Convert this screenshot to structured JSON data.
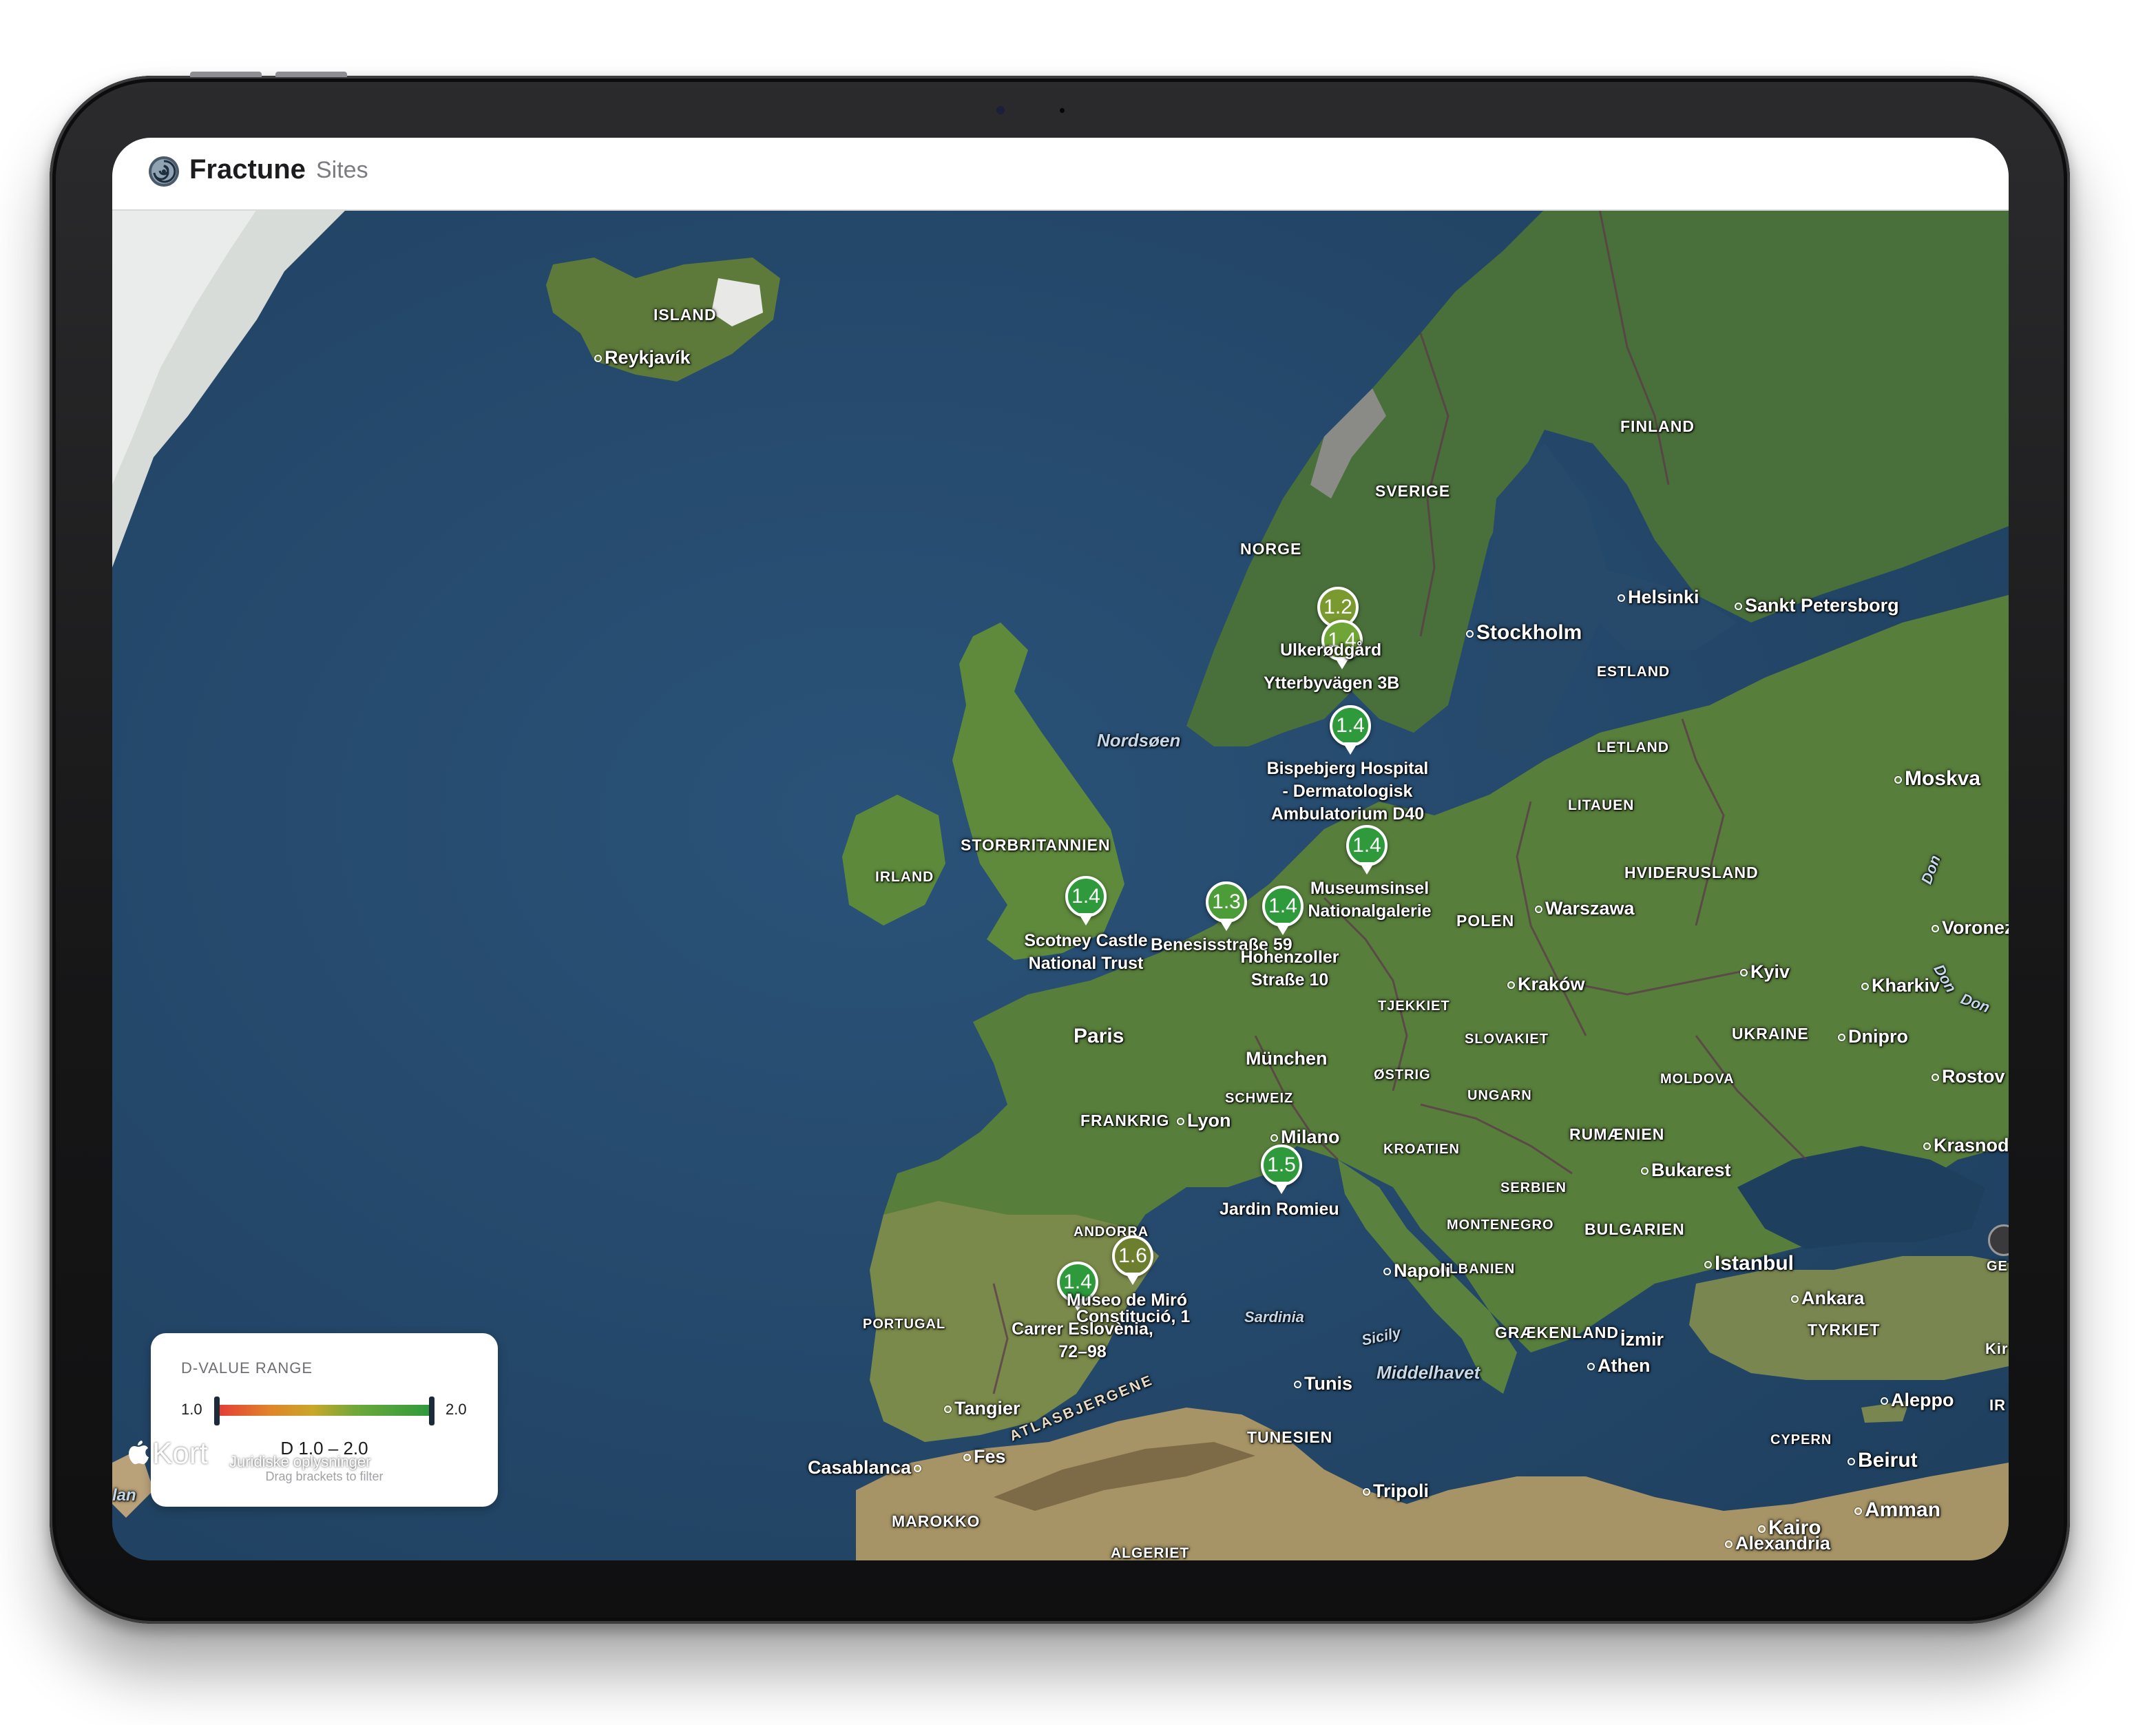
{
  "app": {
    "name": "Fractune",
    "nav_item": "Sites"
  },
  "map": {
    "countries": [
      {
        "key": "island",
        "label": "ISLAND"
      },
      {
        "key": "norge",
        "label": "NORGE"
      },
      {
        "key": "sverige",
        "label": "SVERIGE"
      },
      {
        "key": "finland",
        "label": "FINLAND"
      },
      {
        "key": "estland",
        "label": "ESTLAND"
      },
      {
        "key": "letland",
        "label": "LETLAND"
      },
      {
        "key": "litauen",
        "label": "LITAUEN"
      },
      {
        "key": "hviderusland",
        "label": "HVIDERUSLAND"
      },
      {
        "key": "polen",
        "label": "POLEN"
      },
      {
        "key": "storbritannien",
        "label": "STORBRITANNIEN"
      },
      {
        "key": "irland",
        "label": "IRLAND"
      },
      {
        "key": "tjekkiet",
        "label": "TJEKKIET"
      },
      {
        "key": "slovakiet",
        "label": "SLOVAKIET"
      },
      {
        "key": "ukraine",
        "label": "UKRAINE"
      },
      {
        "key": "moldova",
        "label": "MOLDOVA"
      },
      {
        "key": "ostrig",
        "label": "ØSTRIG"
      },
      {
        "key": "ungarn",
        "label": "UNGARN"
      },
      {
        "key": "schweiz",
        "label": "SCHWEIZ"
      },
      {
        "key": "frankrig",
        "label": "FRANKRIG"
      },
      {
        "key": "kroatien",
        "label": "KROATIEN"
      },
      {
        "key": "rumaenien",
        "label": "RUMÆNIEN"
      },
      {
        "key": "serbien",
        "label": "SERBIEN"
      },
      {
        "key": "montenegro",
        "label": "MONTENEGRO"
      },
      {
        "key": "bulgarien",
        "label": "BULGARIEN"
      },
      {
        "key": "albanien",
        "label": "ALBANIEN"
      },
      {
        "key": "graekenland",
        "label": "GRÆKENLAND"
      },
      {
        "key": "tyrkiet",
        "label": "TYRKIET"
      },
      {
        "key": "andorra",
        "label": "ANDORRA"
      },
      {
        "key": "portugal",
        "label": "PORTUGAL"
      },
      {
        "key": "tunesien",
        "label": "TUNESIEN"
      },
      {
        "key": "marokko",
        "label": "MAROKKO"
      },
      {
        "key": "algeriet",
        "label": "ALGERIET"
      },
      {
        "key": "cypern",
        "label": "CYPERN"
      },
      {
        "key": "atlas",
        "label": "ATLASBJERGENE"
      }
    ],
    "cities": [
      {
        "key": "reykjavik",
        "label": "Reykjavík"
      },
      {
        "key": "stockholm",
        "label": "Stockholm"
      },
      {
        "key": "helsinki",
        "label": "Helsinki"
      },
      {
        "key": "sankt",
        "label": "Sankt Petersborg"
      },
      {
        "key": "moskva",
        "label": "Moskva"
      },
      {
        "key": "warszawa",
        "label": "Warszawa"
      },
      {
        "key": "voronezh",
        "label": "Voronezj"
      },
      {
        "key": "krakow",
        "label": "Kraków"
      },
      {
        "key": "kyiv",
        "label": "Kyiv"
      },
      {
        "key": "kharkiv",
        "label": "Kharkiv"
      },
      {
        "key": "dnipro",
        "label": "Dnipro"
      },
      {
        "key": "rostov",
        "label": "Rostov"
      },
      {
        "key": "krasnodar",
        "label": "Krasnoda"
      },
      {
        "key": "paris",
        "label": "Paris"
      },
      {
        "key": "munchen",
        "label": "München"
      },
      {
        "key": "lyon",
        "label": "Lyon"
      },
      {
        "key": "milano",
        "label": "Milano"
      },
      {
        "key": "bukarest",
        "label": "Bukarest"
      },
      {
        "key": "istanbul",
        "label": "Istanbul"
      },
      {
        "key": "ankara",
        "label": "Ankara"
      },
      {
        "key": "napoli",
        "label": "Napoli"
      },
      {
        "key": "izmir",
        "label": "İzmir"
      },
      {
        "key": "athen",
        "label": "Athen"
      },
      {
        "key": "tunis",
        "label": "Tunis"
      },
      {
        "key": "tangier",
        "label": "Tangier"
      },
      {
        "key": "casablanca",
        "label": "Casablanca"
      },
      {
        "key": "fes",
        "label": "Fes"
      },
      {
        "key": "tripoli",
        "label": "Tripoli"
      },
      {
        "key": "aleppo",
        "label": "Aleppo"
      },
      {
        "key": "beirut",
        "label": "Beirut"
      },
      {
        "key": "amman",
        "label": "Amman"
      },
      {
        "key": "alexandria",
        "label": "Alexandria"
      },
      {
        "key": "kairo",
        "label": "Kairo"
      }
    ],
    "seas": [
      {
        "key": "nordsoen",
        "label": "Nordsøen"
      },
      {
        "key": "middelhavet",
        "label": "Middelhavet"
      },
      {
        "key": "sardinia",
        "label": "Sardinia"
      },
      {
        "key": "sicily",
        "label": "Sicily"
      },
      {
        "key": "don",
        "label": "Don"
      }
    ],
    "edge_fragments": [
      "Kir",
      "IR",
      "GE",
      "lan"
    ],
    "sites": [
      {
        "key": "ulkerodgard",
        "value": "1.2",
        "label": "Ulkerødgård",
        "color": "#7a9a30"
      },
      {
        "key": "ytterbyvagen",
        "value": "1.4",
        "label": "Ytterbyvägen 3B",
        "color": "#6fa436"
      },
      {
        "key": "bispebjerg",
        "value": "1.4",
        "label": "Bispebjerg Hospital - Dermatologisk Ambulatorium D40",
        "color": "#2e9a3c"
      },
      {
        "key": "museumsinsel",
        "value": "1.4",
        "label": "Museumsinsel Nationalgalerie",
        "color": "#2e9a3c"
      },
      {
        "key": "scotney",
        "value": "1.4",
        "label": "Scotney Castle National Trust",
        "color": "#2e9a3c"
      },
      {
        "key": "benesis",
        "value": "1.3",
        "label": "Benesisstraße 59",
        "color": "#4c9d38"
      },
      {
        "key": "hohenzoller",
        "value": "1.4",
        "label": "Hohenzoller Straße 10",
        "color": "#2e9a3c"
      },
      {
        "key": "romieu",
        "value": "1.5",
        "label": "Jardin Romieu",
        "color": "#2e9a3c"
      },
      {
        "key": "miro",
        "value": "1.6",
        "label": "Museo de Miró",
        "color": "#6b7f2e"
      },
      {
        "key": "constitucio",
        "value": "1.4",
        "label": "Carrer Eslovènia, 72–98",
        "color": "#2e9a3c"
      },
      {
        "key": "constitucio_b",
        "value": "",
        "label": "Constitució, 1"
      }
    ]
  },
  "legend": {
    "title": "D-VALUE RANGE",
    "min": "1.0",
    "max": "2.0",
    "range_text": "D 1.0 – 2.0",
    "hint": "Drag brackets to filter"
  },
  "attribution": {
    "provider": "Kort",
    "legal": "Juridiske oplysninger"
  }
}
